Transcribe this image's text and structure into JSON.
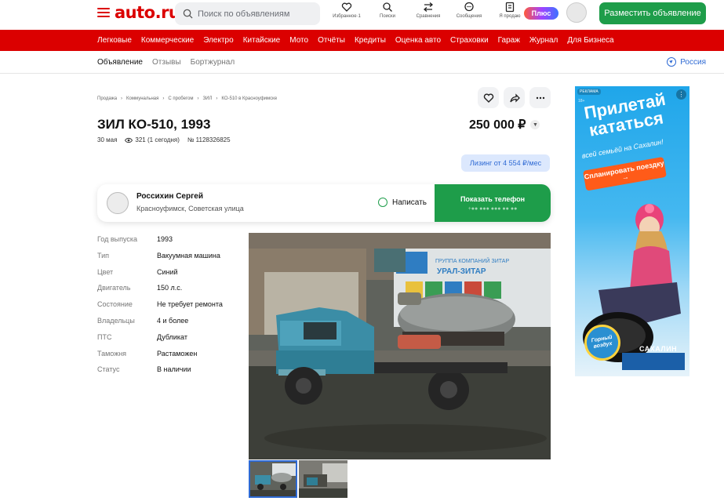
{
  "brand": {
    "logo_text": "auto.ru"
  },
  "search": {
    "placeholder": "Поиск по объявлениям"
  },
  "top_nav": [
    {
      "label": "Избранное·1",
      "icon": "heart-icon"
    },
    {
      "label": "Поиски",
      "icon": "search-alert-icon"
    },
    {
      "label": "Сравнения",
      "icon": "compare-icon"
    },
    {
      "label": "Сообщения",
      "icon": "chat-icon"
    },
    {
      "label": "Я продаю",
      "icon": "sell-icon"
    }
  ],
  "plus_label": "Плюс",
  "post_button": "Разместить объявление",
  "red_nav": [
    "Легковые",
    "Коммерческие",
    "Электро",
    "Китайские",
    "Мото",
    "Отчёты",
    "Кредиты",
    "Оценка авто",
    "Страховки",
    "Гараж",
    "Журнал",
    "Для Бизнеса"
  ],
  "sub_tabs": [
    "Объявление",
    "Отзывы",
    "Бортжурнал"
  ],
  "region": "Россия",
  "breadcrumbs": [
    "Продажа",
    "Коммунальная",
    "С пробегом",
    "ЗИЛ",
    "КО-510 в Красноуфимске"
  ],
  "listing": {
    "title": "ЗИЛ КО-510, 1993",
    "price": "250 000 ₽",
    "date": "30 мая",
    "views": "321 (1 сегодня)",
    "number": "№ 1128326825",
    "leasing": "Лизинг от 4 554 ₽/мес"
  },
  "seller": {
    "name": "Россихин Сергей",
    "location": "Красноуфимск, Советская улица",
    "write_label": "Написать",
    "phone_label": "Показать телефон",
    "phone_masked": "+●● ●●● ●●● ●● ●●"
  },
  "specs": [
    {
      "key": "Год выпуска",
      "value": "1993"
    },
    {
      "key": "Тип",
      "value": "Вакуумная машина"
    },
    {
      "key": "Цвет",
      "value": "Синий"
    },
    {
      "key": "Двигатель",
      "value": "150 л.с."
    },
    {
      "key": "Состояние",
      "value": "Не требует ремонта"
    },
    {
      "key": "Владельцы",
      "value": "4 и более"
    },
    {
      "key": "ПТС",
      "value": "Дубликат"
    },
    {
      "key": "Таможня",
      "value": "Растаможен"
    },
    {
      "key": "Статус",
      "value": "В наличии"
    }
  ],
  "photo": {
    "sign_text": "УРАЛ-ЗИТАР",
    "sign_top": "ГРУППА КОМПАНИЙ ЗИТАР"
  },
  "ad": {
    "label": "РЕКЛАМА",
    "age": "18+",
    "headline_1": "Прилетай",
    "headline_2": "кататься",
    "subline": "всей семьёй на Сахалин!",
    "cta": "Спланировать поездку →",
    "badge": "Горный воздух",
    "brand": "САХАЛИН"
  },
  "colors": {
    "accent_red": "#db0000",
    "green": "#1e9d4a",
    "link_blue": "#2e6ad4"
  }
}
